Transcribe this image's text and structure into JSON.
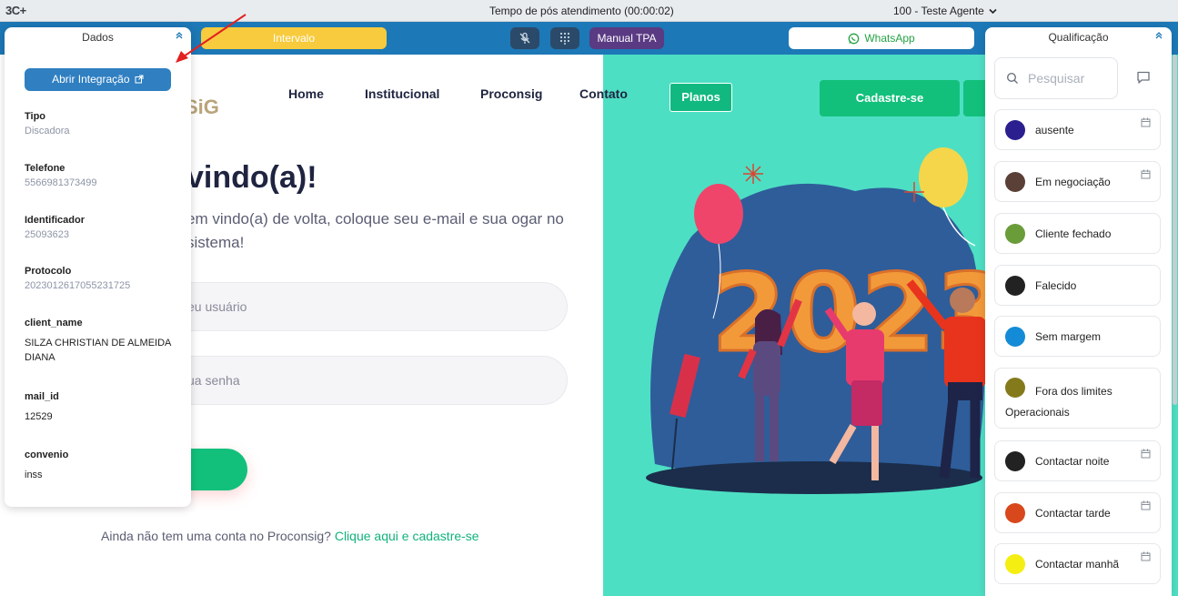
{
  "topbar": {
    "logo": "3C+",
    "timer": "Tempo de pós atendimento (00:00:02)",
    "agent": "100 - Teste Agente"
  },
  "toolbar": {
    "intervalo": "Intervalo",
    "manual_tpa": "Manual TPA",
    "whatsapp": "WhatsApp"
  },
  "site": {
    "logo": "SiG",
    "nav": [
      "Home",
      "Institucional",
      "Proconsig",
      "Contato"
    ],
    "planos": "Planos",
    "cadastro": "Cadastre-se",
    "welcome": "vindo(a)!",
    "welcome_sub": "em vindo(a) de volta, coloque seu e-mail e sua ogar no sistema!",
    "user_placeholder": "eu usuário",
    "password_placeholder": "ua senha",
    "signup_text": "Ainda não tem uma conta no Proconsig?",
    "signup_link": "Clique aqui e cadastre-se",
    "illustration_text": "2023"
  },
  "dados": {
    "title": "Dados",
    "open_integration": "Abrir Integração",
    "fields": [
      {
        "label": "Tipo",
        "value": "Discadora"
      },
      {
        "label": "Telefone",
        "value": "5566981373499"
      },
      {
        "label": "Identificador",
        "value": "25093623"
      },
      {
        "label": "Protocolo",
        "value": "2023012617055231725"
      },
      {
        "label": "client_name",
        "value": "SILZA CHRISTIAN DE ALMEIDA DIANA"
      },
      {
        "label": "mail_id",
        "value": "12529"
      },
      {
        "label": "convenio",
        "value": "inss"
      }
    ]
  },
  "qualificacao": {
    "title": "Qualificação",
    "search_placeholder": "Pesquisar",
    "items": [
      {
        "label": "ausente",
        "color": "#2b1f8f",
        "schedule": true
      },
      {
        "label": "Em negociação",
        "color": "#5b4038",
        "schedule": true
      },
      {
        "label": "Cliente fechado",
        "color": "#6b9c3a",
        "schedule": false
      },
      {
        "label": "Falecido",
        "color": "#222222",
        "schedule": false
      },
      {
        "label": "Sem margem",
        "color": "#138bd6",
        "schedule": false
      },
      {
        "label": "Fora dos limites Operacionais",
        "color": "#847a1c",
        "schedule": false
      },
      {
        "label": "Contactar noite",
        "color": "#222222",
        "schedule": true
      },
      {
        "label": "Contactar tarde",
        "color": "#d8481c",
        "schedule": true
      },
      {
        "label": "Contactar manhã",
        "color": "#f5ee12",
        "schedule": true
      }
    ]
  }
}
